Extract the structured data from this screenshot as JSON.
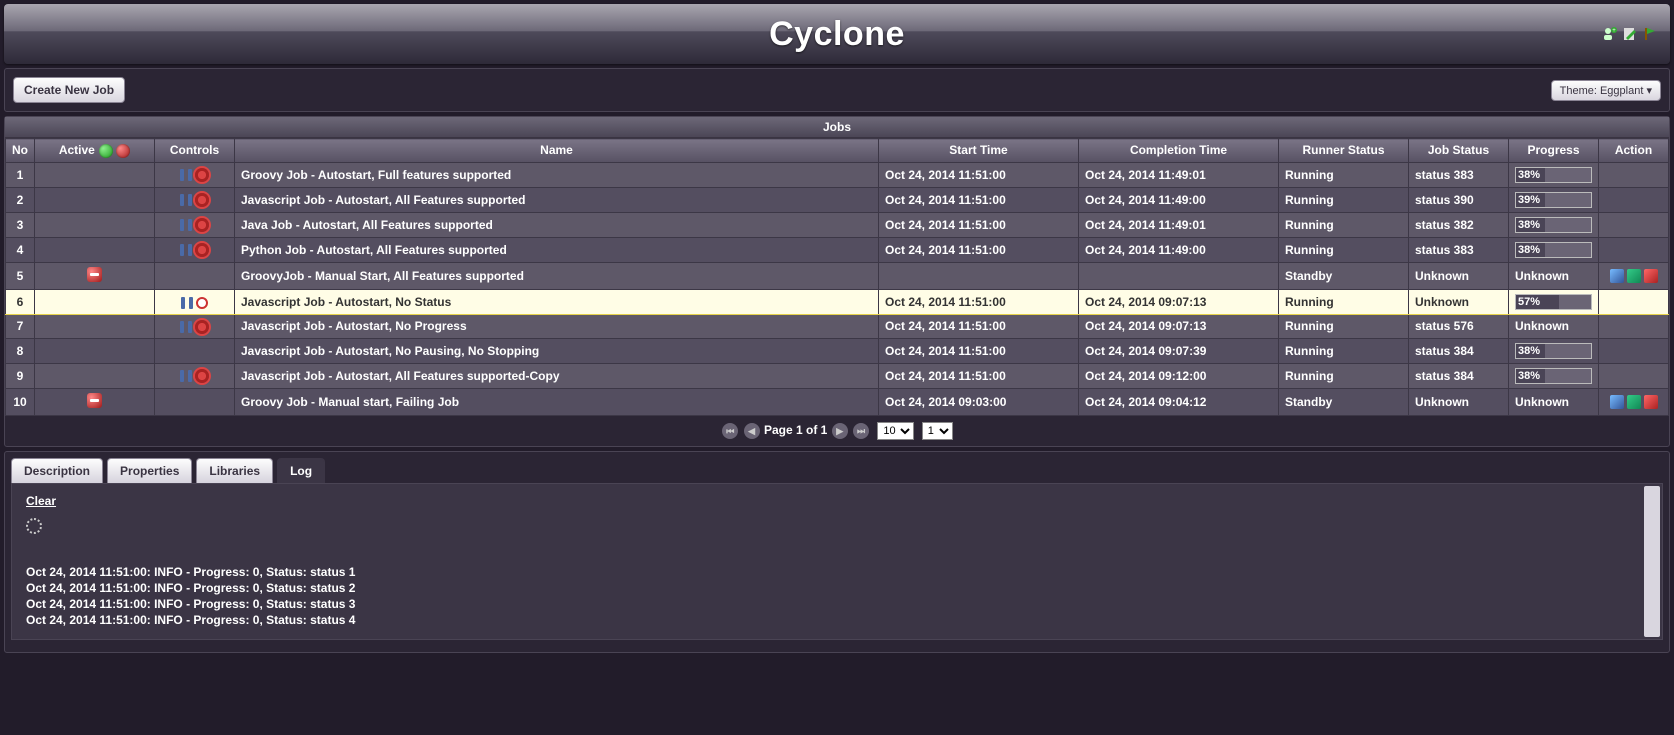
{
  "header": {
    "title": "Cyclone"
  },
  "toolbar": {
    "create_label": "Create New Job",
    "theme_label": "Theme: Eggplant"
  },
  "panel": {
    "title": "Jobs"
  },
  "columns": {
    "no": "No",
    "active": "Active",
    "controls": "Controls",
    "name": "Name",
    "start": "Start Time",
    "completion": "Completion Time",
    "runner": "Runner Status",
    "jobstatus": "Job Status",
    "progress": "Progress",
    "action": "Action"
  },
  "rows": [
    {
      "no": "1",
      "active": "",
      "pause": true,
      "stop": true,
      "record": false,
      "name": "Groovy Job - Autostart, Full features supported",
      "start": "Oct 24, 2014 11:51:00",
      "end": "Oct 24, 2014 11:49:01",
      "runner": "Running",
      "status": "status 383",
      "progress": "38%",
      "pval": 38,
      "actions": false
    },
    {
      "no": "2",
      "active": "",
      "pause": true,
      "stop": true,
      "record": false,
      "name": "Javascript Job - Autostart, All Features supported",
      "start": "Oct 24, 2014 11:51:00",
      "end": "Oct 24, 2014 11:49:00",
      "runner": "Running",
      "status": "status 390",
      "progress": "39%",
      "pval": 39,
      "actions": false
    },
    {
      "no": "3",
      "active": "",
      "pause": true,
      "stop": true,
      "record": false,
      "name": "Java Job - Autostart, All Features supported",
      "start": "Oct 24, 2014 11:51:00",
      "end": "Oct 24, 2014 11:49:01",
      "runner": "Running",
      "status": "status 382",
      "progress": "38%",
      "pval": 38,
      "actions": false
    },
    {
      "no": "4",
      "active": "",
      "pause": true,
      "stop": true,
      "record": false,
      "name": "Python Job - Autostart, All Features supported",
      "start": "Oct 24, 2014 11:51:00",
      "end": "Oct 24, 2014 11:49:00",
      "runner": "Running",
      "status": "status 383",
      "progress": "38%",
      "pval": 38,
      "actions": false
    },
    {
      "no": "5",
      "active": "stop",
      "pause": false,
      "stop": false,
      "record": false,
      "name": "GroovyJob - Manual Start, All Features supported",
      "start": "",
      "end": "",
      "runner": "Standby",
      "status": "Unknown",
      "progress": "Unknown",
      "pval": null,
      "actions": true
    },
    {
      "no": "6",
      "active": "",
      "pause": true,
      "stop": false,
      "record": true,
      "name": "Javascript Job - Autostart, No Status",
      "start": "Oct 24, 2014 11:51:00",
      "end": "Oct 24, 2014 09:07:13",
      "runner": "Running",
      "status": "Unknown",
      "progress": "57%",
      "pval": 57,
      "actions": false,
      "selected": true
    },
    {
      "no": "7",
      "active": "",
      "pause": true,
      "stop": true,
      "record": false,
      "name": "Javascript Job - Autostart, No Progress",
      "start": "Oct 24, 2014 11:51:00",
      "end": "Oct 24, 2014 09:07:13",
      "runner": "Running",
      "status": "status 576",
      "progress": "Unknown",
      "pval": null,
      "actions": false
    },
    {
      "no": "8",
      "active": "",
      "pause": false,
      "stop": false,
      "record": false,
      "name": "Javascript Job - Autostart, No Pausing, No Stopping",
      "start": "Oct 24, 2014 11:51:00",
      "end": "Oct 24, 2014 09:07:39",
      "runner": "Running",
      "status": "status 384",
      "progress": "38%",
      "pval": 38,
      "actions": false
    },
    {
      "no": "9",
      "active": "",
      "pause": true,
      "stop": true,
      "record": false,
      "name": "Javascript Job - Autostart, All Features supported-Copy",
      "start": "Oct 24, 2014 11:51:00",
      "end": "Oct 24, 2014 09:12:00",
      "runner": "Running",
      "status": "status 384",
      "progress": "38%",
      "pval": 38,
      "actions": false
    },
    {
      "no": "10",
      "active": "stop",
      "pause": false,
      "stop": false,
      "record": false,
      "name": "Groovy Job - Manual start, Failing Job",
      "start": "Oct 24, 2014 09:03:00",
      "end": "Oct 24, 2014 09:04:12",
      "runner": "Standby",
      "status": "Unknown",
      "progress": "Unknown",
      "pval": null,
      "actions": true
    }
  ],
  "pager": {
    "text": "Page 1 of 1",
    "pagesize": "10",
    "page": "1"
  },
  "tabs": {
    "description": "Description",
    "properties": "Properties",
    "libraries": "Libraries",
    "log": "Log"
  },
  "log": {
    "clear": "Clear",
    "lines": [
      "Oct 24, 2014 11:51:00: INFO - Progress: 0, Status: status 1",
      "Oct 24, 2014 11:51:00: INFO - Progress: 0, Status: status 2",
      "Oct 24, 2014 11:51:00: INFO - Progress: 0, Status: status 3",
      "Oct 24, 2014 11:51:00: INFO - Progress: 0, Status: status 4"
    ]
  }
}
